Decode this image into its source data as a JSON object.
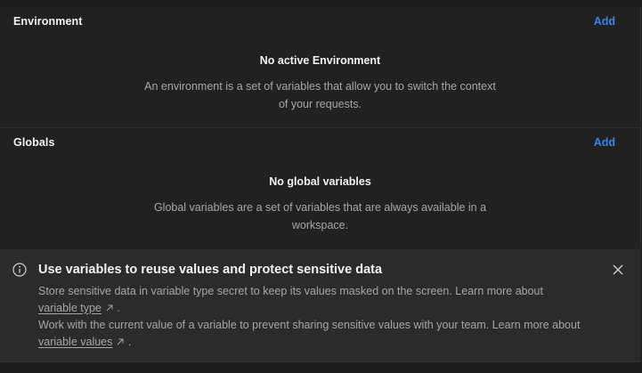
{
  "environment": {
    "title": "Environment",
    "add_label": "Add",
    "empty_title": "No active Environment",
    "empty_description": "An environment is a set of variables that allow you to switch the context of your requests."
  },
  "globals": {
    "title": "Globals",
    "add_label": "Add",
    "empty_title": "No global variables",
    "empty_description": "Global variables are a set of variables that are always available in a workspace."
  },
  "banner": {
    "icon": "info-icon",
    "title": "Use variables to reuse values and protect sensitive data",
    "line1_text": "Store sensitive data in variable type secret to keep its values masked on the screen. Learn more about",
    "line1_link": "variable type",
    "line1_suffix": " .",
    "line2_text": "Work with the current value of a variable to prevent sharing sensitive values with your team. Learn more about",
    "line2_link": "variable values",
    "line2_suffix": " .",
    "close_icon": "close-icon"
  },
  "colors": {
    "background": "#212121",
    "banner_background": "#2b2b2b",
    "accent": "#2f86f6",
    "muted_text": "#a6a6a6"
  }
}
